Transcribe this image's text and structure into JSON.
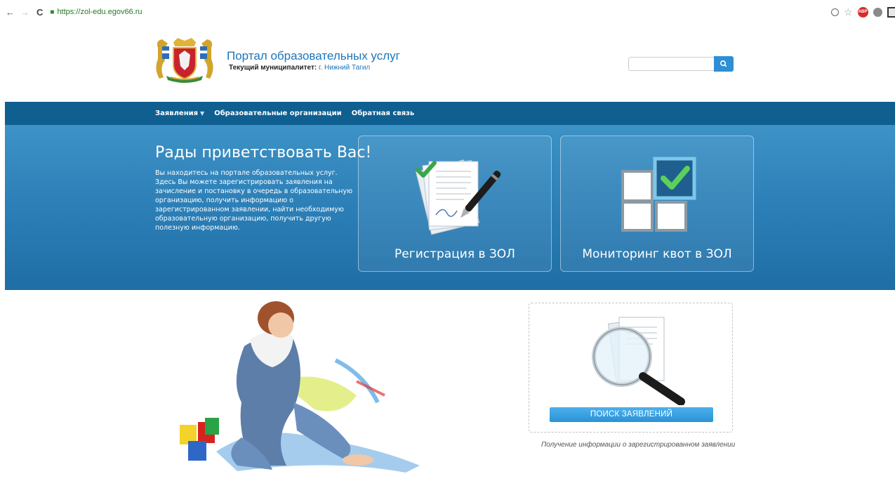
{
  "browser": {
    "url": "https://zol-edu.egov66.ru",
    "extensions": [
      "zoom-icon",
      "bookmark-star-icon",
      "adblock-icon",
      "profile-icon",
      "window-icon"
    ]
  },
  "header": {
    "portal_title": "Портал образовательных услуг",
    "municipality_label": "Текущий муниципалитет:",
    "municipality_value": "г. Нижний Тагил",
    "search": {
      "placeholder": ""
    }
  },
  "nav": {
    "items": [
      {
        "label": "Заявления",
        "has_dropdown": true
      },
      {
        "label": "Образовательные организации",
        "has_dropdown": false
      },
      {
        "label": "Обратная связь",
        "has_dropdown": false
      }
    ]
  },
  "hero": {
    "title": "Рады приветствовать Вас!",
    "text": "Вы находитесь на портале образовательных услуг. Здесь Вы можете зарегистрировать заявления на зачисление и постановку в очередь в образовательную организацию, получить информацию о зарегистрированном заявлении, найти необходимую образовательную организацию, получить другую полезную информацию.",
    "tiles": [
      {
        "label": "Регистрация в ЗОЛ",
        "icon": "documents-pen-icon"
      },
      {
        "label": "Мониторинг квот в ЗОЛ",
        "icon": "checkbox-grid-icon"
      }
    ]
  },
  "search_applications": {
    "button_label": "ПОИСК ЗАЯВЛЕНИЙ",
    "caption": "Получение информации о зарегистрированном заявлении",
    "icon": "magnifier-documents-icon"
  },
  "colors": {
    "nav_band": "#0f5f91",
    "hero_top": "#3d92c6",
    "hero_bottom": "#1f6ea5",
    "link_blue": "#1b75bb",
    "button_blue": "#2a92d6"
  }
}
